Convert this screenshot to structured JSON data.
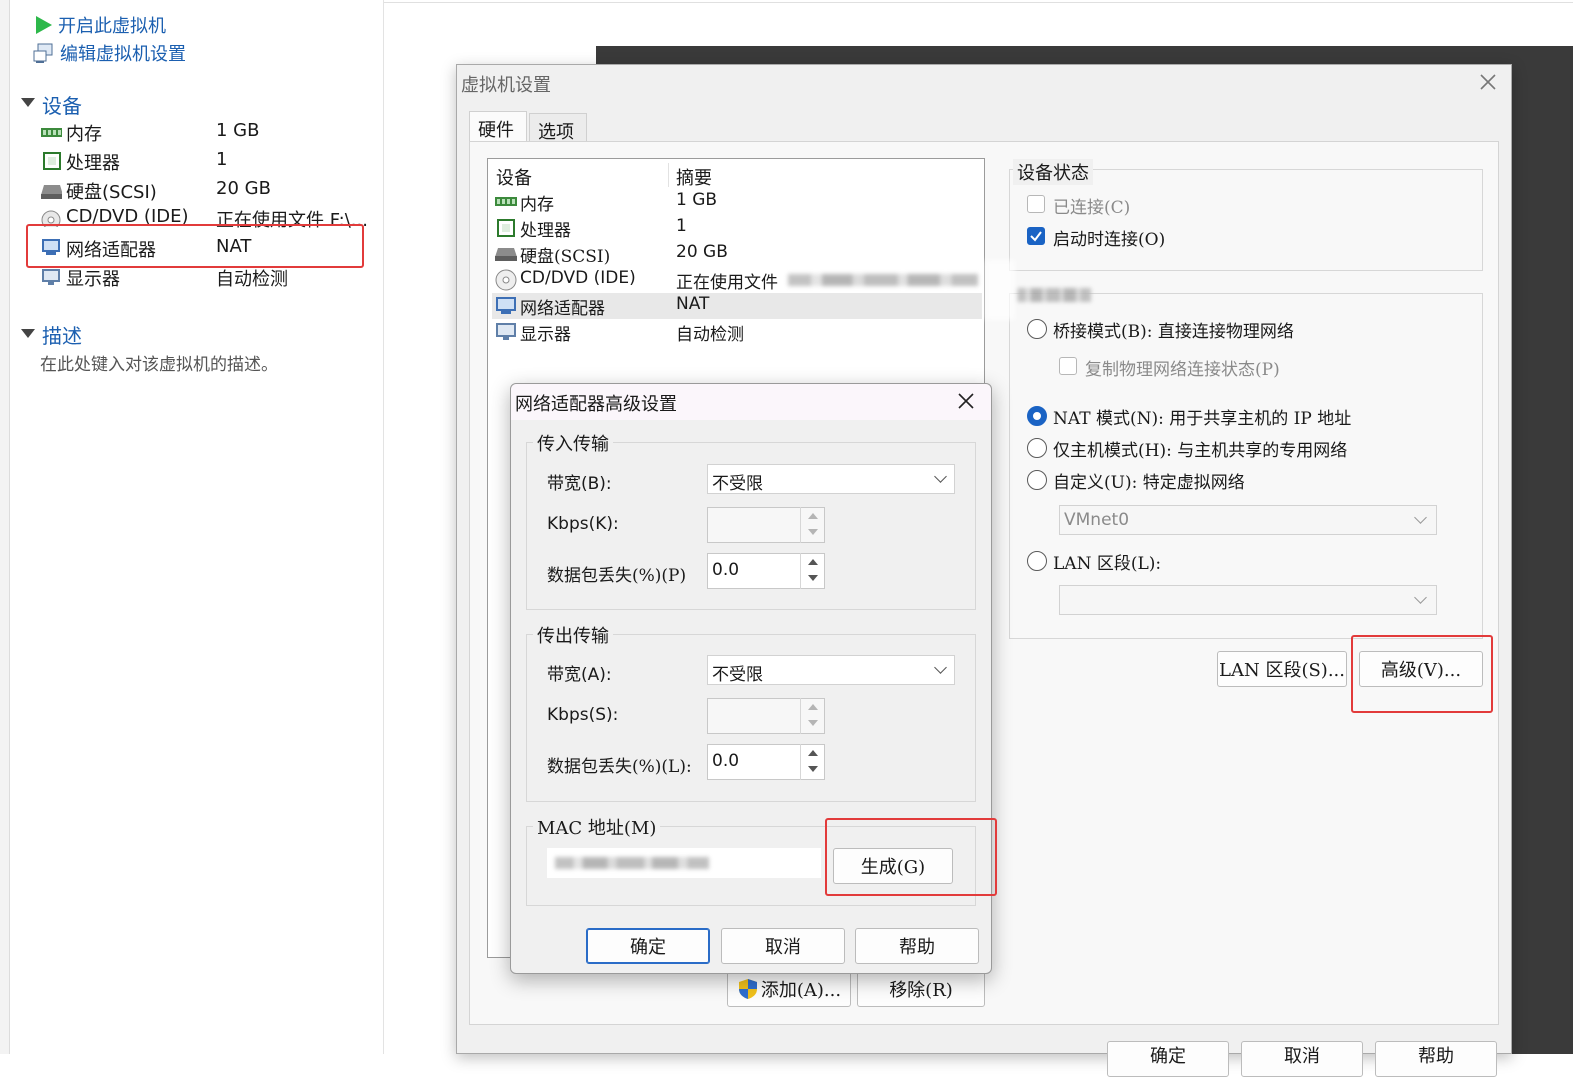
{
  "left_panel": {
    "actions": {
      "power_on": "开启此虚拟机",
      "edit_settings": "编辑虚拟机设置"
    },
    "devices_section": "设备",
    "devices": [
      {
        "name": "内存",
        "value": "1 GB",
        "icon": "memory-icon"
      },
      {
        "name": "处理器",
        "value": "1",
        "icon": "processor-icon"
      },
      {
        "name": "硬盘(SCSI)",
        "value": "20 GB",
        "icon": "harddisk-icon"
      },
      {
        "name": "CD/DVD (IDE)",
        "value": "正在使用文件 F:\\...",
        "icon": "cd-dvd-icon"
      },
      {
        "name": "网络适配器",
        "value": "NAT",
        "icon": "network-adapter-icon"
      },
      {
        "name": "显示器",
        "value": "自动检测",
        "icon": "display-icon"
      }
    ],
    "description_section": "描述",
    "description_placeholder": "在此处键入对该虚拟机的描述。"
  },
  "settings_dialog": {
    "title": "虚拟机设置",
    "tabs": [
      "硬件",
      "选项"
    ],
    "list_headers": {
      "device": "设备",
      "summary": "摘要"
    },
    "devices": [
      {
        "name": "内存",
        "value": "1 GB"
      },
      {
        "name": "处理器",
        "value": "1"
      },
      {
        "name": "硬盘(SCSI)",
        "value": "20 GB"
      },
      {
        "name": "CD/DVD (IDE)",
        "value": "正在使用文件"
      },
      {
        "name": "网络适配器",
        "value": "NAT"
      },
      {
        "name": "显示器",
        "value": "自动检测"
      }
    ],
    "device_status": {
      "label": "设备状态",
      "connected": "已连接(C)",
      "connect_at_power_on": "启动时连接(O)",
      "connected_checked": false,
      "connect_at_power_on_checked": true
    },
    "network": {
      "bridged": "桥接模式(B): 直接连接物理网络",
      "replicate": "复制物理网络连接状态(P)",
      "nat": "NAT 模式(N): 用于共享主机的 IP 地址",
      "host_only": "仅主机模式(H): 与主机共享的专用网络",
      "custom": "自定义(U): 特定虚拟网络",
      "custom_value": "VMnet0",
      "lan_segment": "LAN 区段(L):",
      "selected": "nat"
    },
    "buttons": {
      "lan_segments": "LAN 区段(S)...",
      "advanced": "高级(V)...",
      "add": "添加(A)...",
      "remove": "移除(R)"
    },
    "bottom_buttons": [
      "确定",
      "取消",
      "帮助"
    ]
  },
  "advanced_dialog": {
    "title": "网络适配器高级设置",
    "incoming": {
      "label": "传入传输",
      "bandwidth_label": "带宽(B):",
      "bandwidth_value": "不受限",
      "kbps_label": "Kbps(K):",
      "kbps_value": "",
      "loss_label": "数据包丢失(%)(P)",
      "loss_value": "0.0"
    },
    "outgoing": {
      "label": "传出传输",
      "bandwidth_label": "带宽(A):",
      "bandwidth_value": "不受限",
      "kbps_label": "Kbps(S):",
      "kbps_value": "",
      "loss_label": "数据包丢失(%)(L):",
      "loss_value": "0.0"
    },
    "mac": {
      "label": "MAC 地址(M)",
      "generate": "生成(G)"
    },
    "buttons": {
      "ok": "确定",
      "cancel": "取消",
      "help": "帮助"
    }
  },
  "colors": {
    "link": "#1b5fb0",
    "highlight": "#e23b3b",
    "accent": "#1a63c4"
  }
}
